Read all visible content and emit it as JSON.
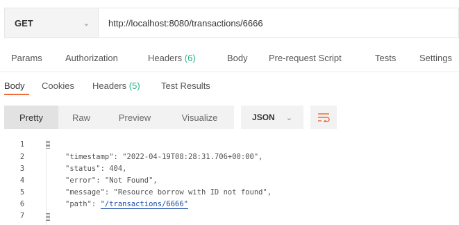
{
  "request": {
    "method": "GET",
    "url": "http://localhost:8080/transactions/6666",
    "method_chevron": "chevron-down-icon"
  },
  "request_tabs": {
    "params": "Params",
    "authorization": "Authorization",
    "headers": "Headers",
    "headers_count": "(6)",
    "body": "Body",
    "pre_request": "Pre-request Script",
    "tests": "Tests",
    "settings": "Settings"
  },
  "response_tabs": {
    "body": "Body",
    "cookies": "Cookies",
    "headers": "Headers",
    "headers_count": "(5)",
    "test_results": "Test Results",
    "active": "Body"
  },
  "view": {
    "pretty": "Pretty",
    "raw": "Raw",
    "preview": "Preview",
    "visualize": "Visualize",
    "active": "Pretty",
    "format": "JSON",
    "wrap_icon": "wrap-lines-icon"
  },
  "code_lines": {
    "n1": "1",
    "n2": "2",
    "n3": "3",
    "n4": "4",
    "n5": "5",
    "n6": "6",
    "n7": "7",
    "l2": "\"timestamp\": \"2022-04-19T08:28:31.706+00:00\",",
    "l3": "\"status\": 404,",
    "l4": "\"error\": \"Not Found\",",
    "l5": "\"message\": \"Resource borrow with ID not found\",",
    "l6_key": "\"path\": ",
    "l6_value": "\"/transactions/6666\""
  },
  "colors": {
    "accent": "#f26b3a",
    "count_green": "#26b47f",
    "link_blue": "#1b4aa8"
  }
}
